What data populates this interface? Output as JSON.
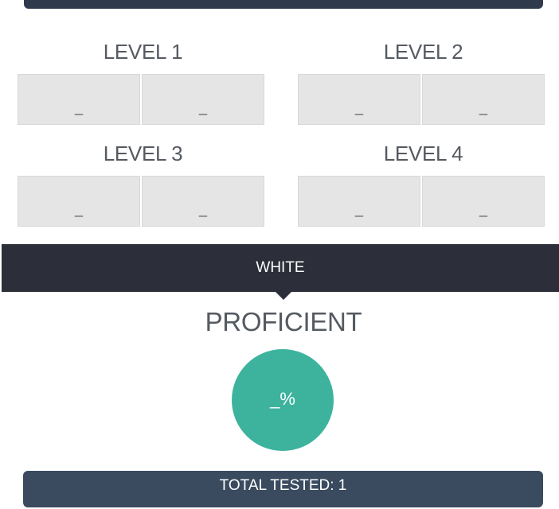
{
  "levels": [
    {
      "title": "LEVEL 1",
      "values": [
        "_",
        "_"
      ]
    },
    {
      "title": "LEVEL 2",
      "values": [
        "_",
        "_"
      ]
    },
    {
      "title": "LEVEL 3",
      "values": [
        "_",
        "_"
      ]
    },
    {
      "title": "LEVEL 4",
      "values": [
        "_",
        "_"
      ]
    }
  ],
  "group": {
    "label": "WHITE"
  },
  "proficiency": {
    "title": "PROFICIENT",
    "percent": "_%"
  },
  "summary": {
    "total_tested": "TOTAL TESTED: 1"
  },
  "colors": {
    "banner": "#2c2f39",
    "circle": "#3db39e",
    "total_bar": "#3a4a5f",
    "box": "#e5e5e5"
  }
}
